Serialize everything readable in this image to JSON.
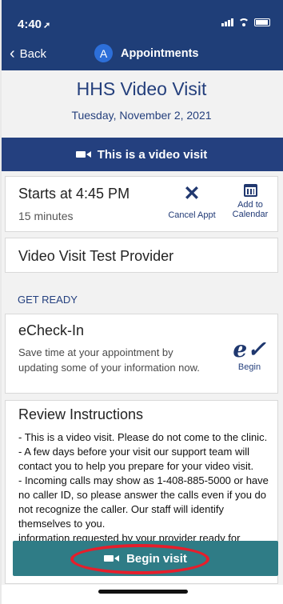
{
  "status_bar": {
    "time": "4:40"
  },
  "nav": {
    "back_label": "Back",
    "avatar_letter": "A",
    "title": "Appointments"
  },
  "header": {
    "title": "HHS Video Visit",
    "date": "Tuesday, November 2, 2021"
  },
  "video_notice": {
    "label": "This is a video visit"
  },
  "appointment": {
    "start_text": "Starts at 4:45 PM",
    "duration": "15 minutes",
    "cancel_label": "Cancel Appt",
    "calendar_label_line1": "Add to",
    "calendar_label_line2": "Calendar"
  },
  "provider": {
    "name": "Video Visit Test Provider"
  },
  "section": {
    "label": "GET READY"
  },
  "echeck": {
    "title": "eCheck-In",
    "description": "Save time at your appointment by updating some of your information now.",
    "button_label": "Begin"
  },
  "instructions": {
    "title": "Review Instructions",
    "lines": [
      "- This is a video visit.  Please do not come to the clinic.",
      "- A few days before your visit our support team will contact you to help you prepare for your video visit.",
      "- Incoming calls may show as 1-408-885-5000 or have no caller ID, so please answer the calls even if you do not recognize the caller. Our staff will identify themselves to you.",
      "information requested by your provider ready for"
    ]
  },
  "primary_action": {
    "label": "Begin visit"
  },
  "colors": {
    "navy": "#1f3e78",
    "teal_button": "#2f7c86",
    "highlight_red": "#e61e2b"
  }
}
